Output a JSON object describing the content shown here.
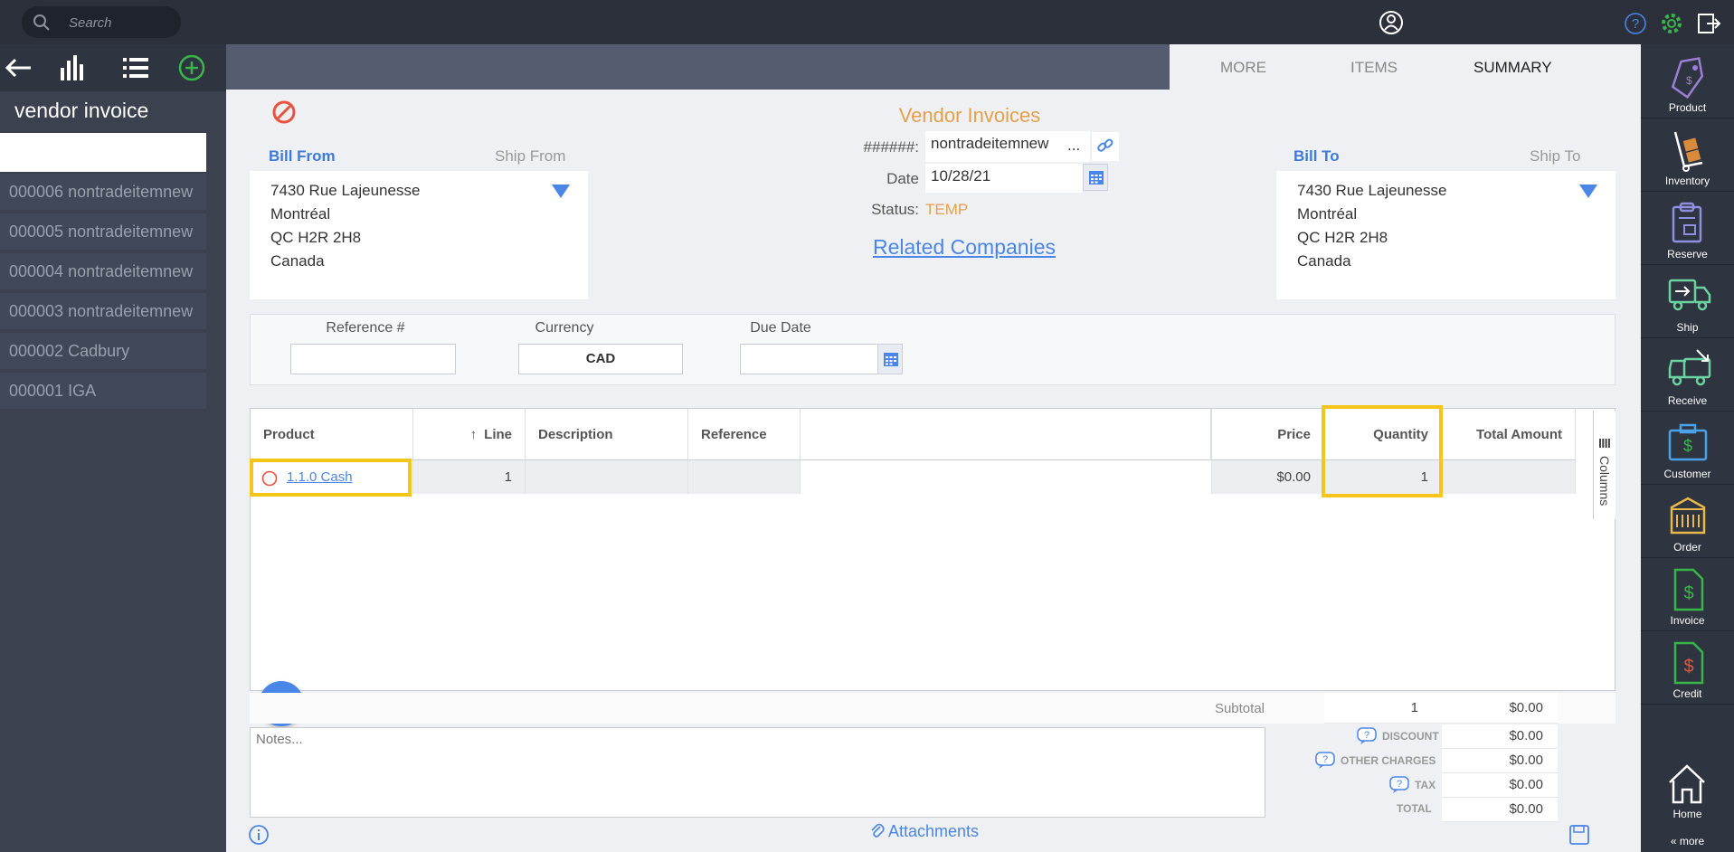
{
  "topbar": {
    "search_placeholder": "Search"
  },
  "sidebar": {
    "title": "vendor invoice",
    "items": [
      {
        "label": "000006 nontradeitemnew"
      },
      {
        "label": "000005 nontradeitemnew"
      },
      {
        "label": "000004 nontradeitemnew"
      },
      {
        "label": "000003 nontradeitemnew"
      },
      {
        "label": "000002 Cadbury"
      },
      {
        "label": "000001 IGA"
      }
    ]
  },
  "tabs": {
    "more": "MORE",
    "items": "ITEMS",
    "summary": "SUMMARY",
    "active": "SUMMARY"
  },
  "form": {
    "title": "Vendor Invoices",
    "bill_from_label": "Bill From",
    "ship_from_label": "Ship From",
    "bill_from_address": [
      "7430 Rue Lajeunesse",
      "Montréal",
      "QC H2R 2H8",
      "Canada"
    ],
    "bill_to_label": "Bill To",
    "ship_to_label": "Ship To",
    "bill_to_address": [
      "7430 Rue Lajeunesse",
      "Montréal",
      "QC H2R 2H8",
      "Canada"
    ],
    "number_label": "######:",
    "number_value": "nontradeitemnew",
    "number_more": "...",
    "date_label": "Date",
    "date_value": "10/28/21",
    "status_label": "Status:",
    "status_value": "TEMP",
    "related_companies": "Related Companies",
    "reference_label": "Reference #",
    "reference_value": "",
    "currency_label": "Currency",
    "currency_value": "CAD",
    "due_date_label": "Due Date",
    "due_date_value": ""
  },
  "grid": {
    "headers": {
      "product": "Product",
      "line": "Line",
      "description": "Description",
      "reference": "Reference",
      "price": "Price",
      "quantity": "Quantity",
      "total_amount": "Total Amount"
    },
    "columns_tab": "Columns",
    "rows": [
      {
        "product": "1.1.0 Cash",
        "line": "1",
        "description": "",
        "reference": "",
        "price": "$0.00",
        "quantity": "1",
        "total_amount": ""
      }
    ]
  },
  "summary": {
    "subtotal_label": "Subtotal",
    "subtotal_qty": "1",
    "subtotal_value": "$0.00",
    "discount_label": "DISCOUNT",
    "discount_value": "$0.00",
    "other_charges_label": "OTHER CHARGES",
    "other_charges_value": "$0.00",
    "tax_label": "TAX",
    "tax_value": "$0.00",
    "total_label": "TOTAL",
    "total_value": "$0.00"
  },
  "notes_placeholder": "Notes...",
  "attachments_label": "Attachments",
  "rightbar": {
    "items": [
      {
        "label": "Product",
        "icon": "product-tag-icon"
      },
      {
        "label": "Inventory",
        "icon": "hand-truck-icon"
      },
      {
        "label": "Reserve",
        "icon": "clipboard-icon"
      },
      {
        "label": "Ship",
        "icon": "ship-truck-icon"
      },
      {
        "label": "Receive",
        "icon": "receive-truck-icon"
      },
      {
        "label": "Customer",
        "icon": "briefcase-dollar-icon"
      },
      {
        "label": "Order",
        "icon": "order-box-icon"
      },
      {
        "label": "Invoice",
        "icon": "invoice-document-icon"
      },
      {
        "label": "Credit",
        "icon": "credit-document-icon"
      }
    ],
    "home": "Home",
    "more": "« more"
  },
  "colors": {
    "accent_blue": "#4a86e8",
    "title_orange": "#e4a04a",
    "highlight_yellow": "#f5c518",
    "cancel_red": "#e8523f"
  }
}
